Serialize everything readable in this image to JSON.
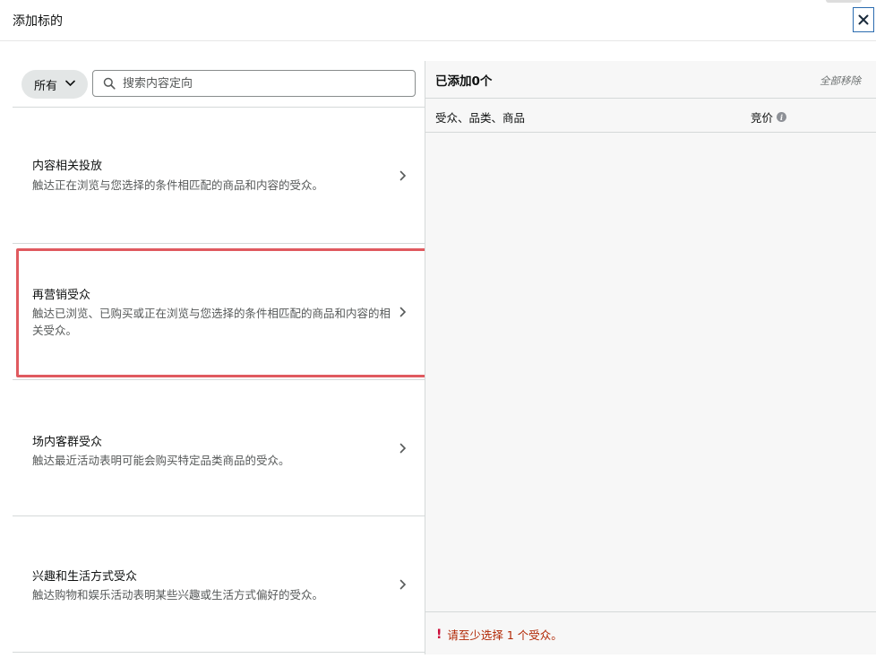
{
  "modal": {
    "title": "添加标的"
  },
  "filter": {
    "selected": "所有",
    "search_placeholder": "搜索内容定向"
  },
  "categories": [
    {
      "title": "内容相关投放",
      "description": "触达正在浏览与您选择的条件相匹配的商品和内容的受众。"
    },
    {
      "title": "再营销受众",
      "description": "触达已浏览、已购买或正在浏览与您选择的条件相匹配的商品和内容的相关受众。"
    },
    {
      "title": "场内客群受众",
      "description": "触达最近活动表明可能会购买特定品类商品的受众。"
    },
    {
      "title": "兴趣和生活方式受众",
      "description": "触达购物和娱乐活动表明某些兴趣或生活方式偏好的受众。"
    }
  ],
  "right": {
    "added_label": "已添加0个",
    "remove_all": "全部移除",
    "col_audience": "受众、品类、商品",
    "col_bid": "竞价",
    "warning": "请至少选择 1 个受众。"
  },
  "icons": {
    "close": "close-icon",
    "chevron": "chevron-down-icon",
    "search": "search-icon",
    "arrow": "chevron-right-icon",
    "info": "info-icon",
    "warning": "exclamation-icon"
  },
  "colors": {
    "highlight": "#e05a5f",
    "warning": "#b12704",
    "close_border": "#2b6cb0"
  }
}
